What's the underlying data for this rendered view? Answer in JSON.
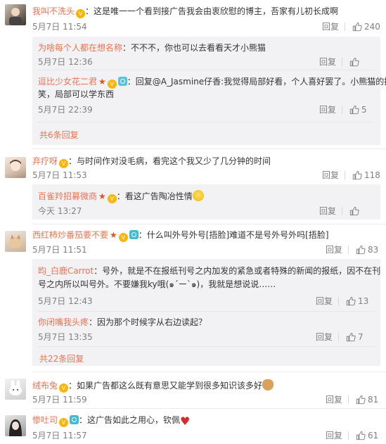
{
  "reply_label": "回复",
  "comments": [
    {
      "username": "我叫不洗头",
      "text": "：这是唯一一个看到接广告我会由衷欣慰的博主，吾家有儿初长成啊",
      "time": "5月7日 11:54",
      "likes": "240",
      "replies": [
        {
          "username": "为啥每个人都在想名称",
          "text": "：不不不，你也可以去看看天才小熊猫",
          "time": "5月7日 12:36",
          "likes": ""
        },
        {
          "username": "逗比少女花二君",
          "text_line1": "：回复@A_Jasmine仔香:我觉得局部好看，个人喜好罢了。小熊猫的搞",
          "text_line2": "笑，局部可以学东西",
          "mention": "@A_Jasmine仔香",
          "time": "5月7日 22:39",
          "likes": "5"
        }
      ],
      "more_label": "共6条回复"
    },
    {
      "username": "弃疗呀",
      "text": "：与时间作对没毛病，看完这个我又少了几分钟的时间",
      "time": "5月7日 11:53",
      "likes": "118",
      "replies": [
        {
          "username": "百雀羚招募微商",
          "text": "：看这广告陶冶性情",
          "time": "今天 13:27",
          "likes": ""
        }
      ]
    },
    {
      "username": "西红柿炒番茄要不要",
      "text": "：什么叫外号外号[捂脸]难道不是号外号外吗[捂脸]",
      "time": "5月7日 11:51",
      "likes": "83",
      "replies": [
        {
          "username": "昀_白鹿Carrot",
          "text_line1": "：号外，就是不在报纸刊号之内加发的紧急或者特殊的新闻的报纸，因不在刊",
          "text_line2": "号之内所以叫号外。不要嫌我ky哦(๑´ー`๑)，我就是想说说……",
          "time": "5月7日 12:43",
          "likes": "13"
        },
        {
          "username": "你闭嘴我头疼",
          "text": "：因为那个时候字从右边读起？",
          "time": "5月7日 13:35",
          "likes": "7"
        }
      ],
      "more_label": "共22条回复"
    },
    {
      "username": "绒布兔",
      "text": "：如果广告都这么既有意思又能学到很多知识该多好",
      "time": "5月7日 11:59",
      "likes": "81"
    },
    {
      "username": "惨吐司",
      "text": "：这广告如此之用心，钦佩",
      "time": "5月7日 11:57",
      "likes": "61"
    }
  ],
  "colors": {
    "username": "#eb7350",
    "meta": "#808080",
    "subbox_bg": "#f2f2f5"
  }
}
